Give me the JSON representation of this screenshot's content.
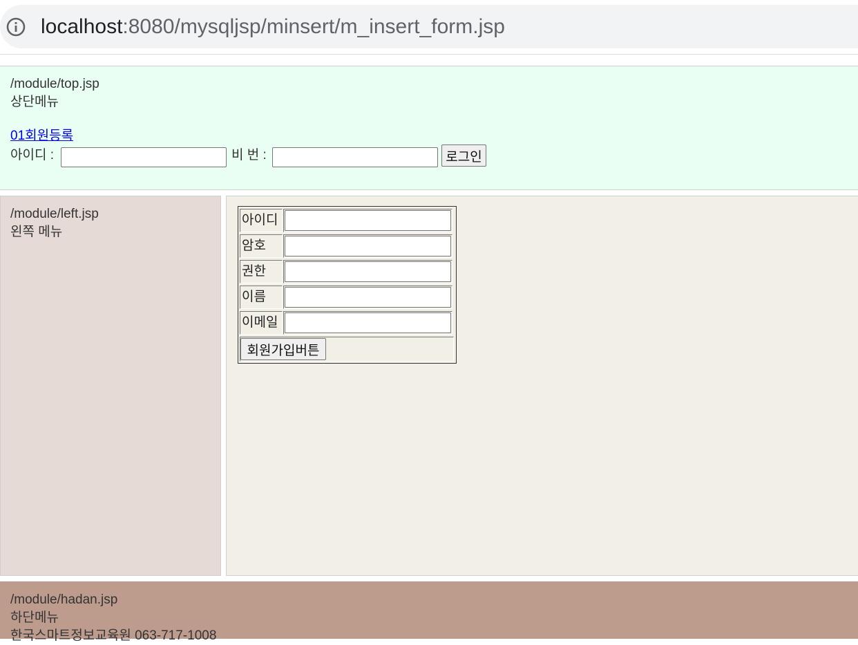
{
  "browser": {
    "url_host": "localhost",
    "url_rest": ":8080/mysqljsp/minsert/m_insert_form.jsp"
  },
  "top": {
    "path": "/module/top.jsp",
    "title": "상단메뉴",
    "register_link": "01회원등록",
    "id_label": "아이디 :",
    "pw_label": "비 번 :",
    "id_value": "",
    "pw_value": "",
    "login_button": "로그인"
  },
  "left": {
    "path": "/module/left.jsp",
    "title": "왼쪽 메뉴"
  },
  "form": {
    "rows": [
      {
        "label": "아이디",
        "value": ""
      },
      {
        "label": "암호",
        "value": ""
      },
      {
        "label": "권한",
        "value": ""
      },
      {
        "label": "이름",
        "value": ""
      },
      {
        "label": "이메일",
        "value": ""
      }
    ],
    "submit_label": "회원가입버튼"
  },
  "footer": {
    "path": "/module/hadan.jsp",
    "title": "하단메뉴",
    "org": "한국스마트정보교육원 063-717-1008"
  },
  "colors": {
    "top_bg": "#eafff3",
    "left_bg": "#e6dad6",
    "main_bg": "#f2f0e6",
    "footer_bg": "#bd9c8d",
    "link": "#0000ee"
  }
}
